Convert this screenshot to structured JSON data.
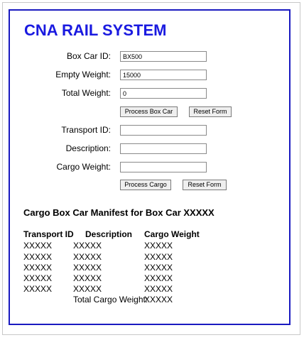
{
  "title": "CNA RAIL SYSTEM",
  "boxcar_form": {
    "boxcar_id_label": "Box Car ID:",
    "boxcar_id_value": "BX500",
    "empty_weight_label": "Empty Weight:",
    "empty_weight_value": "15000",
    "total_weight_label": "Total Weight:",
    "total_weight_value": "0",
    "process_button": "Process Box Car",
    "reset_button": "Reset Form"
  },
  "cargo_form": {
    "transport_id_label": "Transport ID:",
    "transport_id_value": "",
    "description_label": "Description:",
    "description_value": "",
    "cargo_weight_label": "Cargo Weight:",
    "cargo_weight_value": "",
    "process_button": "Process Cargo",
    "reset_button": "Reset Form"
  },
  "manifest": {
    "title": "Cargo Box Car Manifest for Box Car XXXXX",
    "headers": [
      "Transport ID",
      "Description",
      "Cargo Weight"
    ],
    "rows": [
      [
        "XXXXX",
        "XXXXX",
        "XXXXX"
      ],
      [
        "XXXXX",
        "XXXXX",
        "XXXXX"
      ],
      [
        "XXXXX",
        "XXXXX",
        "XXXXX"
      ],
      [
        "XXXXX",
        "XXXXX",
        "XXXXX"
      ],
      [
        "XXXXX",
        "XXXXX",
        "XXXXX"
      ]
    ],
    "total_label": "Total Cargo Weight:",
    "total_value": "XXXXX"
  },
  "colors": {
    "frame_border": "#1a1ac0",
    "title": "#1a1ae0"
  }
}
